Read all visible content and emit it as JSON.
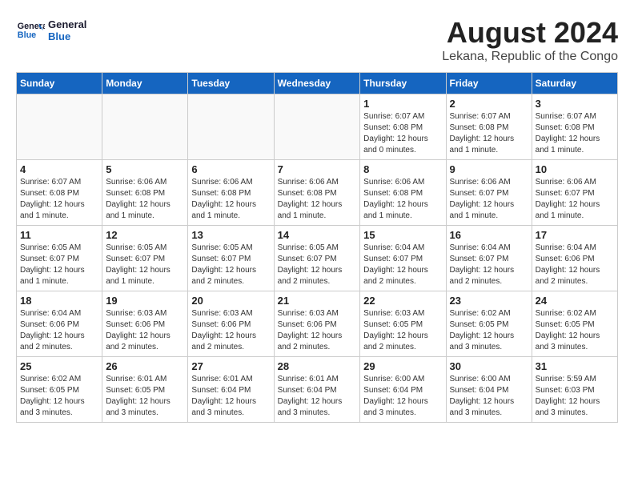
{
  "header": {
    "logo_general": "General",
    "logo_blue": "Blue",
    "month_year": "August 2024",
    "location": "Lekana, Republic of the Congo"
  },
  "weekdays": [
    "Sunday",
    "Monday",
    "Tuesday",
    "Wednesday",
    "Thursday",
    "Friday",
    "Saturday"
  ],
  "weeks": [
    [
      {
        "day": "",
        "info": ""
      },
      {
        "day": "",
        "info": ""
      },
      {
        "day": "",
        "info": ""
      },
      {
        "day": "",
        "info": ""
      },
      {
        "day": "1",
        "info": "Sunrise: 6:07 AM\nSunset: 6:08 PM\nDaylight: 12 hours\nand 0 minutes."
      },
      {
        "day": "2",
        "info": "Sunrise: 6:07 AM\nSunset: 6:08 PM\nDaylight: 12 hours\nand 1 minute."
      },
      {
        "day": "3",
        "info": "Sunrise: 6:07 AM\nSunset: 6:08 PM\nDaylight: 12 hours\nand 1 minute."
      }
    ],
    [
      {
        "day": "4",
        "info": "Sunrise: 6:07 AM\nSunset: 6:08 PM\nDaylight: 12 hours\nand 1 minute."
      },
      {
        "day": "5",
        "info": "Sunrise: 6:06 AM\nSunset: 6:08 PM\nDaylight: 12 hours\nand 1 minute."
      },
      {
        "day": "6",
        "info": "Sunrise: 6:06 AM\nSunset: 6:08 PM\nDaylight: 12 hours\nand 1 minute."
      },
      {
        "day": "7",
        "info": "Sunrise: 6:06 AM\nSunset: 6:08 PM\nDaylight: 12 hours\nand 1 minute."
      },
      {
        "day": "8",
        "info": "Sunrise: 6:06 AM\nSunset: 6:08 PM\nDaylight: 12 hours\nand 1 minute."
      },
      {
        "day": "9",
        "info": "Sunrise: 6:06 AM\nSunset: 6:07 PM\nDaylight: 12 hours\nand 1 minute."
      },
      {
        "day": "10",
        "info": "Sunrise: 6:06 AM\nSunset: 6:07 PM\nDaylight: 12 hours\nand 1 minute."
      }
    ],
    [
      {
        "day": "11",
        "info": "Sunrise: 6:05 AM\nSunset: 6:07 PM\nDaylight: 12 hours\nand 1 minute."
      },
      {
        "day": "12",
        "info": "Sunrise: 6:05 AM\nSunset: 6:07 PM\nDaylight: 12 hours\nand 1 minute."
      },
      {
        "day": "13",
        "info": "Sunrise: 6:05 AM\nSunset: 6:07 PM\nDaylight: 12 hours\nand 2 minutes."
      },
      {
        "day": "14",
        "info": "Sunrise: 6:05 AM\nSunset: 6:07 PM\nDaylight: 12 hours\nand 2 minutes."
      },
      {
        "day": "15",
        "info": "Sunrise: 6:04 AM\nSunset: 6:07 PM\nDaylight: 12 hours\nand 2 minutes."
      },
      {
        "day": "16",
        "info": "Sunrise: 6:04 AM\nSunset: 6:07 PM\nDaylight: 12 hours\nand 2 minutes."
      },
      {
        "day": "17",
        "info": "Sunrise: 6:04 AM\nSunset: 6:06 PM\nDaylight: 12 hours\nand 2 minutes."
      }
    ],
    [
      {
        "day": "18",
        "info": "Sunrise: 6:04 AM\nSunset: 6:06 PM\nDaylight: 12 hours\nand 2 minutes."
      },
      {
        "day": "19",
        "info": "Sunrise: 6:03 AM\nSunset: 6:06 PM\nDaylight: 12 hours\nand 2 minutes."
      },
      {
        "day": "20",
        "info": "Sunrise: 6:03 AM\nSunset: 6:06 PM\nDaylight: 12 hours\nand 2 minutes."
      },
      {
        "day": "21",
        "info": "Sunrise: 6:03 AM\nSunset: 6:06 PM\nDaylight: 12 hours\nand 2 minutes."
      },
      {
        "day": "22",
        "info": "Sunrise: 6:03 AM\nSunset: 6:05 PM\nDaylight: 12 hours\nand 2 minutes."
      },
      {
        "day": "23",
        "info": "Sunrise: 6:02 AM\nSunset: 6:05 PM\nDaylight: 12 hours\nand 3 minutes."
      },
      {
        "day": "24",
        "info": "Sunrise: 6:02 AM\nSunset: 6:05 PM\nDaylight: 12 hours\nand 3 minutes."
      }
    ],
    [
      {
        "day": "25",
        "info": "Sunrise: 6:02 AM\nSunset: 6:05 PM\nDaylight: 12 hours\nand 3 minutes."
      },
      {
        "day": "26",
        "info": "Sunrise: 6:01 AM\nSunset: 6:05 PM\nDaylight: 12 hours\nand 3 minutes."
      },
      {
        "day": "27",
        "info": "Sunrise: 6:01 AM\nSunset: 6:04 PM\nDaylight: 12 hours\nand 3 minutes."
      },
      {
        "day": "28",
        "info": "Sunrise: 6:01 AM\nSunset: 6:04 PM\nDaylight: 12 hours\nand 3 minutes."
      },
      {
        "day": "29",
        "info": "Sunrise: 6:00 AM\nSunset: 6:04 PM\nDaylight: 12 hours\nand 3 minutes."
      },
      {
        "day": "30",
        "info": "Sunrise: 6:00 AM\nSunset: 6:04 PM\nDaylight: 12 hours\nand 3 minutes."
      },
      {
        "day": "31",
        "info": "Sunrise: 5:59 AM\nSunset: 6:03 PM\nDaylight: 12 hours\nand 3 minutes."
      }
    ]
  ]
}
